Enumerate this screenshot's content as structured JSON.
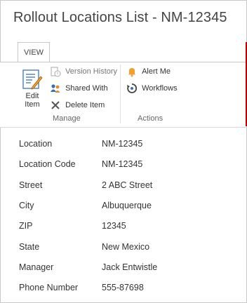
{
  "page": {
    "title": "Rollout Locations List - NM-12345"
  },
  "ribbon": {
    "tab_label": "VIEW",
    "edit_item": {
      "line1": "Edit",
      "line2": "Item"
    },
    "version_history": "Version History",
    "shared_with": "Shared With",
    "delete_item": "Delete Item",
    "manage_label": "Manage",
    "alert_me": "Alert Me",
    "workflows": "Workflows",
    "actions_label": "Actions"
  },
  "fields": [
    {
      "label": "Location",
      "value": "NM-12345"
    },
    {
      "label": "Location Code",
      "value": "NM-12345"
    },
    {
      "label": "Street",
      "value": "2 ABC Street"
    },
    {
      "label": "City",
      "value": "Albuquerque"
    },
    {
      "label": "ZIP",
      "value": "12345"
    },
    {
      "label": "State",
      "value": "New Mexico"
    },
    {
      "label": "Manager",
      "value": "Jack Entwistle"
    },
    {
      "label": "Phone Number",
      "value": "555-87698"
    }
  ],
  "colors": {
    "accent": "#0072c6",
    "border": "#c6c6c6",
    "red_edge": "#c00000",
    "bell": "#f0a030"
  }
}
